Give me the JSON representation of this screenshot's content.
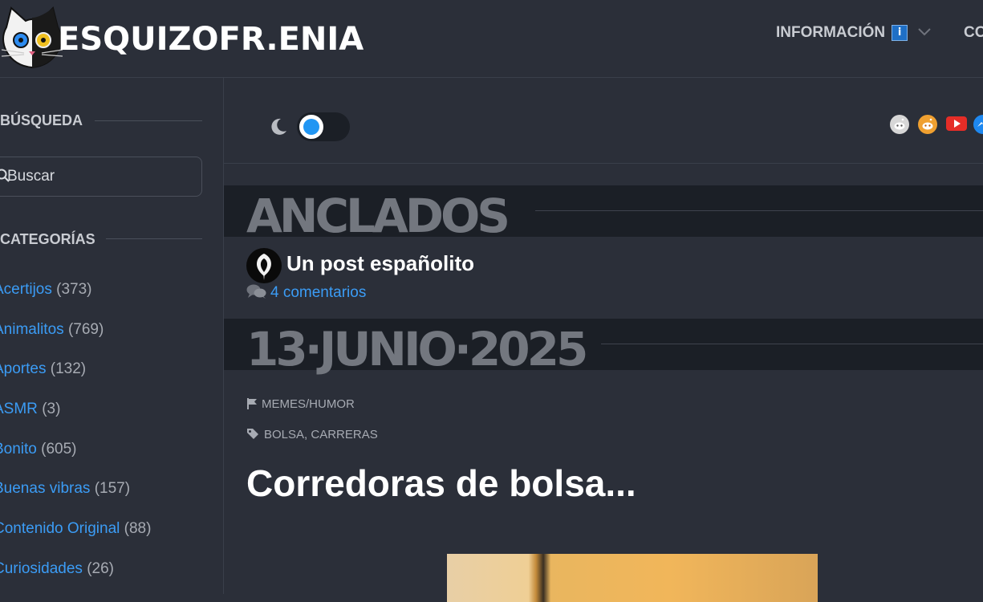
{
  "header": {
    "logo_text": "ESQUIZOFR.ENIA",
    "nav": [
      {
        "label": "INFORMACIÓN",
        "badge": "i"
      },
      {
        "label": "CO"
      }
    ]
  },
  "sidebar": {
    "search_heading": "BÚSQUEDA",
    "search_placeholder": "Buscar",
    "categories_heading": "CATEGORÍAS",
    "categories": [
      {
        "name": "Acertijos",
        "count": "(373)"
      },
      {
        "name": "Animalitos",
        "count": "(769)"
      },
      {
        "name": "Aportes",
        "count": "(132)"
      },
      {
        "name": "ASMR",
        "count": "(3)"
      },
      {
        "name": "Bonito",
        "count": "(605)"
      },
      {
        "name": "Buenas vibras",
        "count": "(157)"
      },
      {
        "name": "Contenido Original",
        "count": "(88)"
      },
      {
        "name": "Curiosidades",
        "count": "(26)"
      }
    ]
  },
  "main": {
    "theme_toggle": {
      "state": "dark"
    },
    "socials": [
      "reddit-icon",
      "reddit-icon",
      "youtube-icon",
      "messenger-icon"
    ],
    "pinned_heading": "ANCLADOS",
    "pinned_post": {
      "title": "Un post españolito",
      "comments": "4 comentarios"
    },
    "date_heading": "13·JUNIO·2025",
    "post": {
      "category": "MEMES/HUMOR",
      "tags": [
        "BOLSA",
        "CARRERAS"
      ],
      "tag_separator": ", ",
      "title": "Corredoras de bolsa..."
    }
  },
  "colors": {
    "background": "#2b2f39",
    "band": "#1b1f26",
    "link": "#3b9cf5",
    "accent": "#2196f3"
  }
}
